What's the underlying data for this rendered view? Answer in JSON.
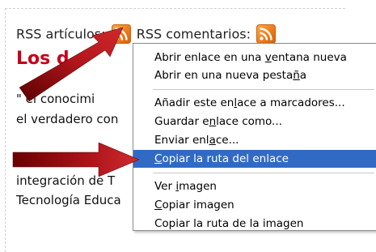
{
  "rss": {
    "articles_label": "RSS artículos:",
    "comments_label": "RSS comentarios:",
    "icon": "rss-feed-icon",
    "icon_color": "#ef7a1a"
  },
  "post": {
    "title": "Los d",
    "title_color": "#c6001a",
    "lines": [
      "\"   el conocimi",
      "el verdadero con",
      "integración de T",
      "Tecnología Educa"
    ]
  },
  "context_menu": {
    "selected_color": "#316ac5",
    "items": [
      {
        "pre": "Abrir enlace en una ",
        "key": "v",
        "post": "entana nueva"
      },
      {
        "pre": "Abrir en una nueva pesta",
        "key": "ñ",
        "post": "a"
      },
      {
        "pre": "Añadir este en",
        "key": "l",
        "post": "ace a marcadores..."
      },
      {
        "pre": "Guardar e",
        "key": "n",
        "post": "lace como..."
      },
      {
        "pre": "Enviar enl",
        "key": "a",
        "post": "ce..."
      },
      {
        "pre": "",
        "key": "C",
        "post": "opiar la ruta del enlace"
      },
      {
        "pre": "Ver ",
        "key": "i",
        "post": "magen"
      },
      {
        "pre": "",
        "key": "C",
        "post": "opiar imagen"
      },
      {
        "pre": "Copiar la ruta de la imagen",
        "key": "",
        "post": ""
      }
    ]
  },
  "arrows": {
    "color": "#a8141b",
    "icon_1": "arrow-pointing-to-rss-icon",
    "icon_2": "arrow-pointing-to-copy-link-item"
  }
}
